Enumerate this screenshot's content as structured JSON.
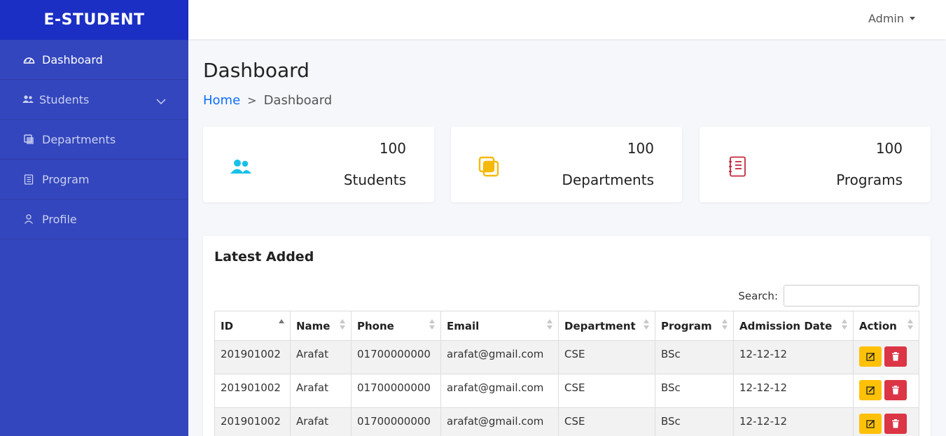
{
  "brand": "E-STUDENT",
  "sidebar": {
    "items": [
      {
        "label": "Dashboard",
        "icon": "gauge-icon"
      },
      {
        "label": "Students",
        "icon": "users-icon"
      },
      {
        "label": "Departments",
        "icon": "clone-icon"
      },
      {
        "label": "Program",
        "icon": "notebook-icon"
      },
      {
        "label": "Profile",
        "icon": "user-icon"
      }
    ]
  },
  "topbar": {
    "user": "Admin"
  },
  "page": {
    "title": "Dashboard",
    "breadcrumb": {
      "home": "Home",
      "sep": ">",
      "current": "Dashboard"
    }
  },
  "cards": [
    {
      "value": "100",
      "label": "Students",
      "color": "#17c1e8"
    },
    {
      "value": "100",
      "label": "Departments",
      "color": "#f5b90a"
    },
    {
      "value": "100",
      "label": "Programs",
      "color": "#c5283d"
    }
  ],
  "latest": {
    "title": "Latest Added",
    "search_label": "Search:",
    "columns": [
      "ID",
      "Name",
      "Phone",
      "Email",
      "Department",
      "Program",
      "Admission Date",
      "Action"
    ],
    "rows": [
      {
        "id": "201901002",
        "name": "Arafat",
        "phone": "01700000000",
        "email": "arafat@gmail.com",
        "department": "CSE",
        "program": "BSc",
        "date": "12-12-12"
      },
      {
        "id": "201901002",
        "name": "Arafat",
        "phone": "01700000000",
        "email": "arafat@gmail.com",
        "department": "CSE",
        "program": "BSc",
        "date": "12-12-12"
      },
      {
        "id": "201901002",
        "name": "Arafat",
        "phone": "01700000000",
        "email": "arafat@gmail.com",
        "department": "CSE",
        "program": "BSc",
        "date": "12-12-12"
      }
    ]
  },
  "colors": {
    "sidebar": "#3446bd",
    "brand_bg": "#1b2fc4",
    "edit": "#ffc107",
    "delete": "#dc3545",
    "link": "#0d6efd"
  }
}
